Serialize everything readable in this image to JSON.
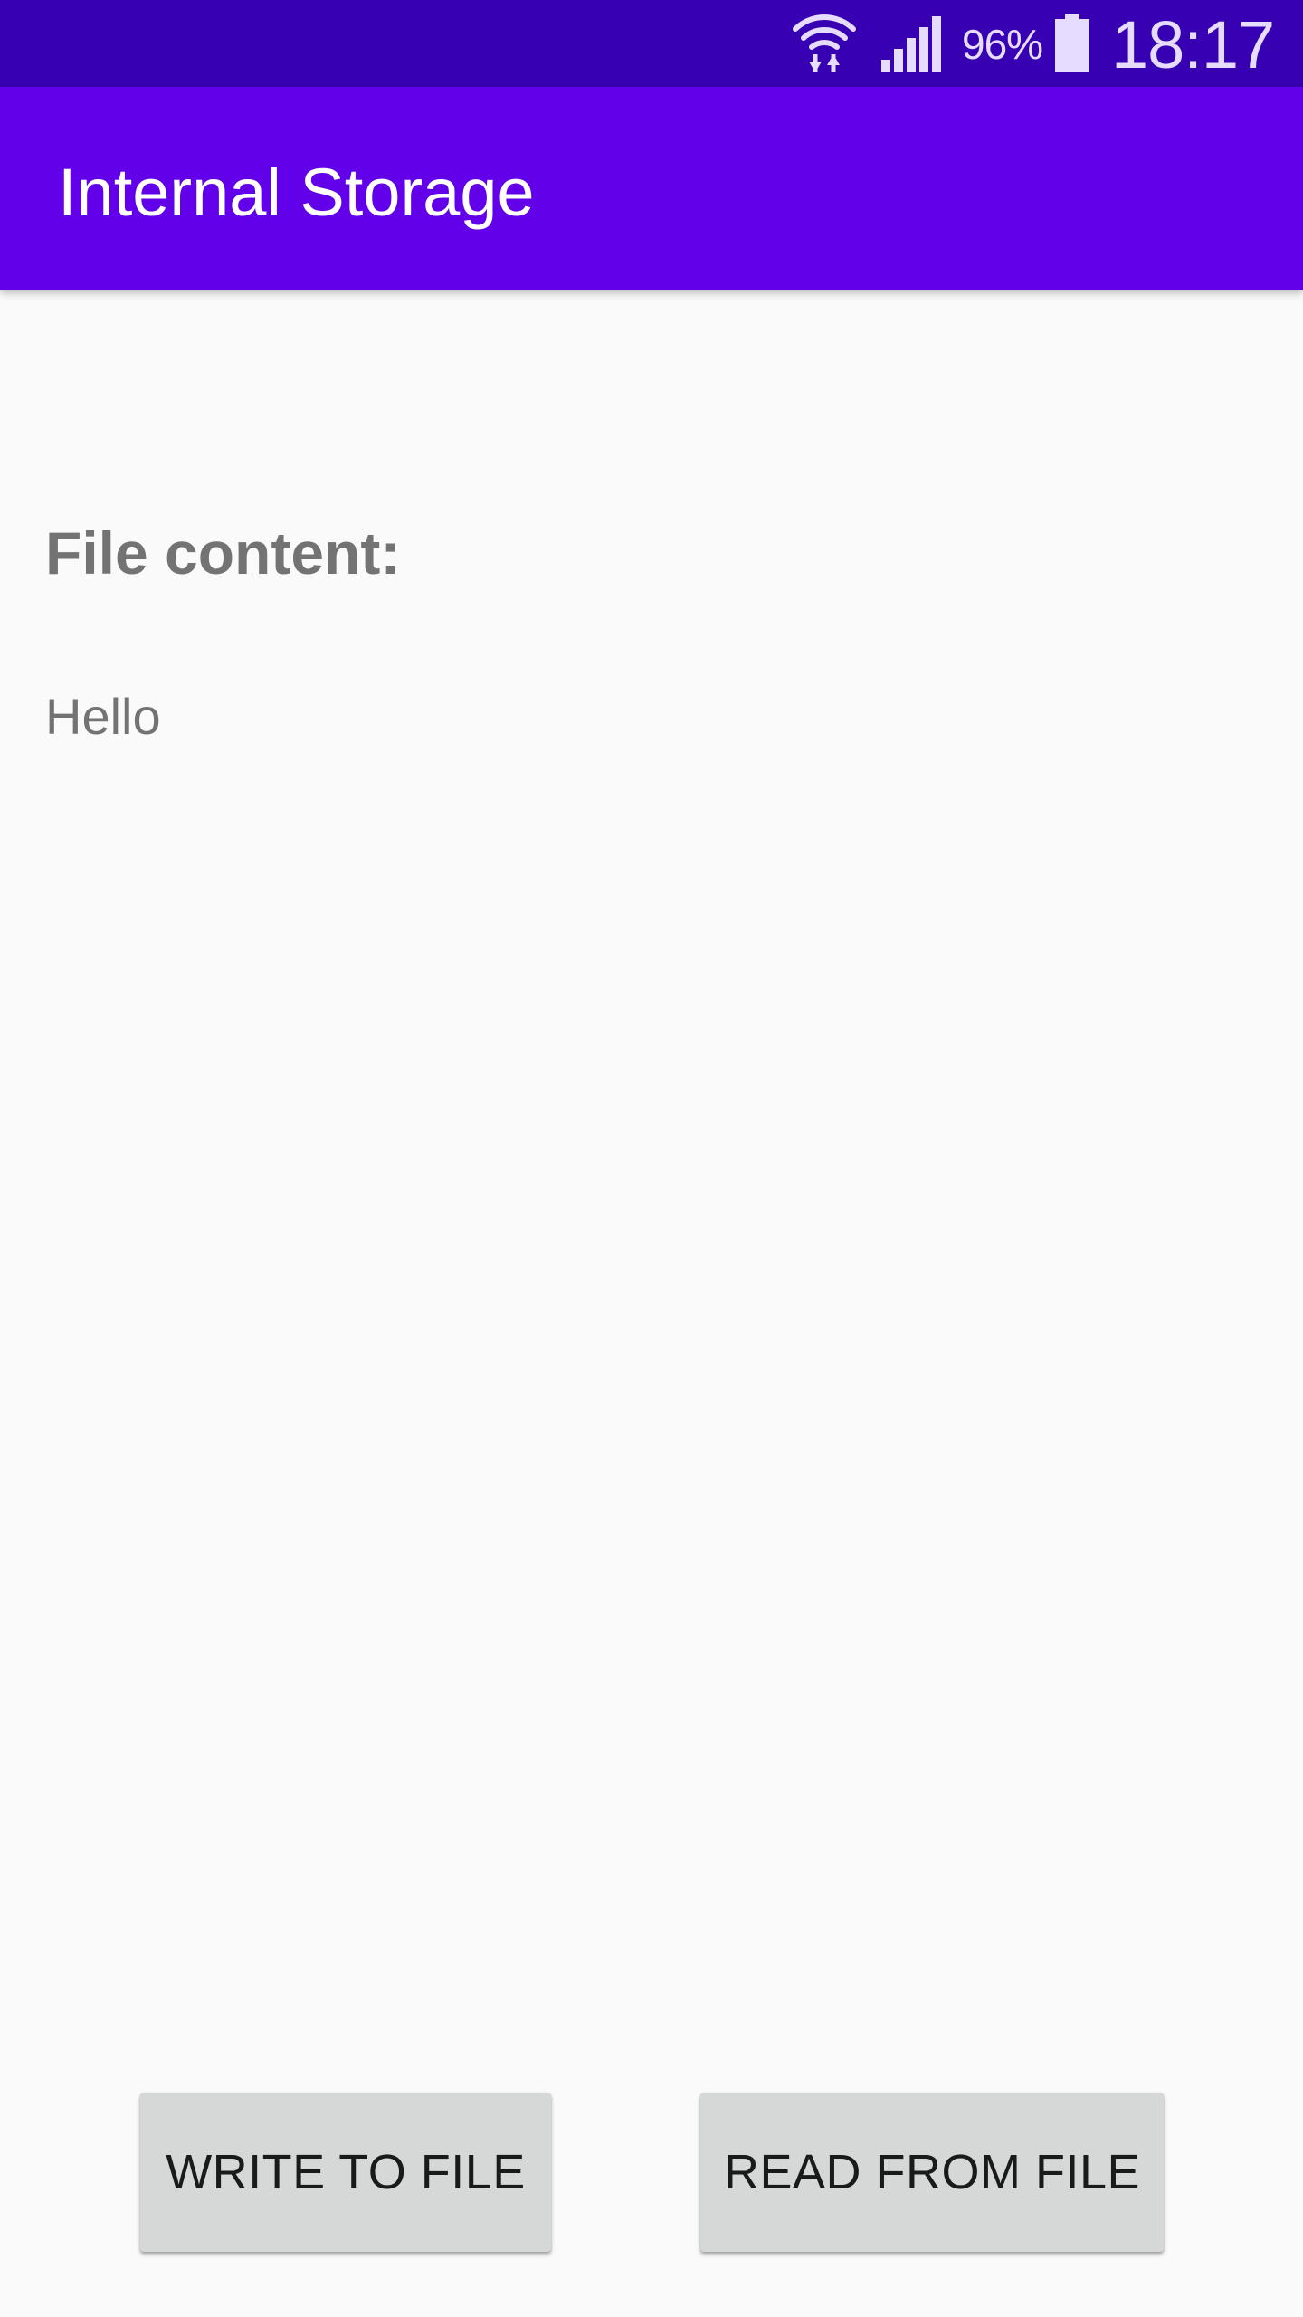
{
  "status_bar": {
    "wifi_icon": "wifi-data-icon",
    "signal_icon": "cellular-signal-icon",
    "battery_percent": "96%",
    "battery_icon": "battery-icon",
    "time": "18:17"
  },
  "app_bar": {
    "title": "Internal Storage"
  },
  "content": {
    "label": "File content:",
    "text": "Hello"
  },
  "buttons": {
    "write_label": "WRITE TO FILE",
    "read_label": "READ FROM FILE"
  },
  "colors": {
    "status_bar": "#3700b3",
    "app_bar": "#6200ea",
    "background": "#fafafa",
    "button": "#d6d7d7",
    "label_text": "#737373"
  }
}
